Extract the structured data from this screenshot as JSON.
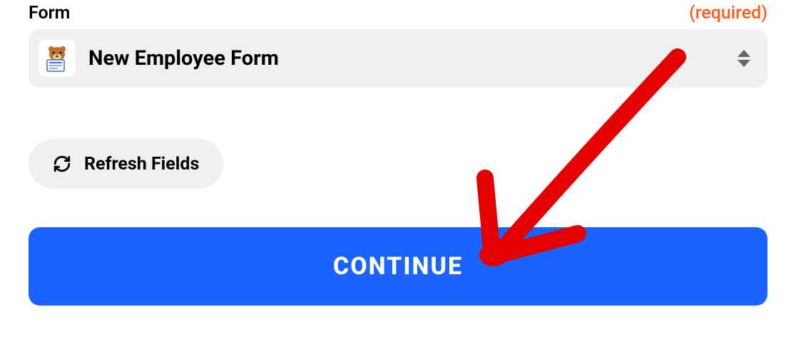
{
  "form_field": {
    "label": "Form",
    "required_text": "(required)",
    "selected_value": "New Employee Form",
    "app_icon_name": "wpforms-icon"
  },
  "refresh_button": {
    "label": "Refresh Fields"
  },
  "continue_button": {
    "label": "CONTINUE"
  },
  "colors": {
    "accent": "#1a63ff",
    "required": "#ff5c1a",
    "pill_bg": "#f0f0f0",
    "annotation": "#e40000"
  }
}
